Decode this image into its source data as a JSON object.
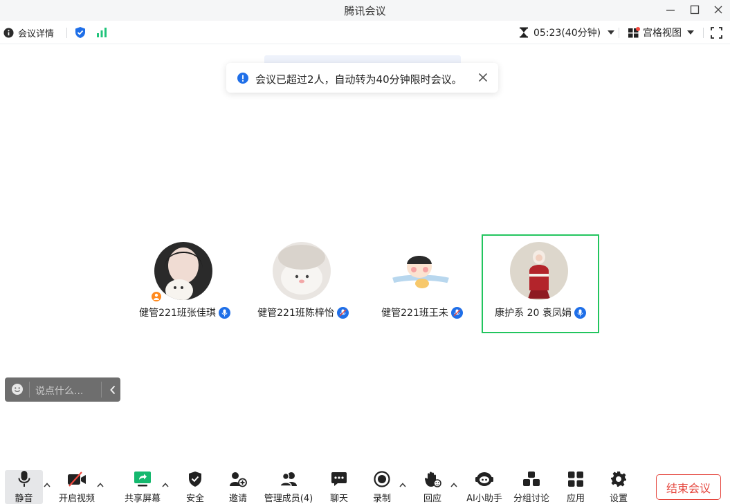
{
  "window": {
    "title": "腾讯会议"
  },
  "infobar": {
    "details_label": "会议详情",
    "timer": "05:23(40分钟)",
    "view_label": "宫格视图"
  },
  "toast": {
    "message": "会议已超过2人，自动转为40分钟限时会议。"
  },
  "participants": [
    {
      "name": "健管221班张佳琪",
      "is_host": true,
      "speaking": false
    },
    {
      "name": "健管221班陈梓怡",
      "is_host": false,
      "speaking": false
    },
    {
      "name": "健管221班王未",
      "is_host": false,
      "speaking": false
    },
    {
      "name": "康护系 20 袁凤娟",
      "is_host": false,
      "speaking": true
    }
  ],
  "chat": {
    "placeholder": "说点什么..."
  },
  "toolbar": {
    "mute": "静音",
    "video": "开启视频",
    "share": "共享屏幕",
    "security": "安全",
    "invite": "邀请",
    "members": "管理成员(4)",
    "chat": "聊天",
    "record": "录制",
    "react": "回应",
    "ai": "AI小助手",
    "breakout": "分组讨论",
    "apps": "应用",
    "settings": "设置",
    "end": "结束会议"
  },
  "colors": {
    "accent": "#1f6fe8",
    "end": "#e5463d",
    "active_border": "#22c55e",
    "signal": "#21c47b"
  }
}
